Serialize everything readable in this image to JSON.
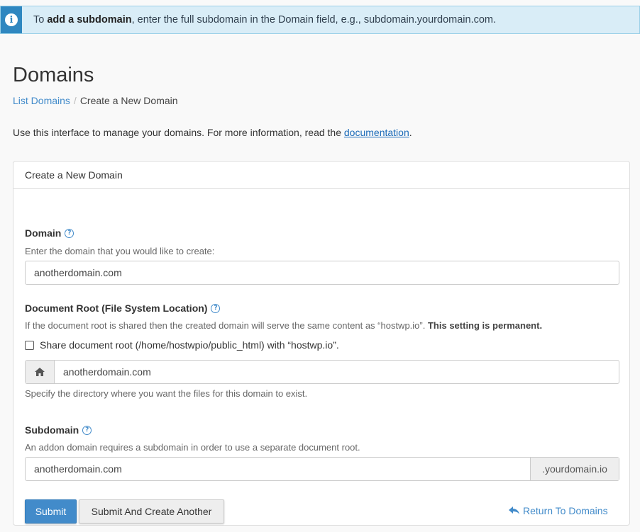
{
  "alert": {
    "prefix": "To ",
    "bold": "add a subdomain",
    "suffix": ", enter the full subdomain in the Domain field, e.g., subdomain.yourdomain.com.",
    "icon": "info-icon"
  },
  "page": {
    "title": "Domains",
    "breadcrumb": {
      "link": "List Domains",
      "separator": "/",
      "current": "Create a New Domain"
    },
    "intro": {
      "text": "Use this interface to manage your domains. For more information, read the ",
      "link": "documentation",
      "end": "."
    }
  },
  "panel": {
    "heading": "Create a New Domain",
    "domain": {
      "label": "Domain",
      "hint": "Enter the domain that you would like to create:",
      "value": "anotherdomain.com"
    },
    "docroot": {
      "label": "Document Root (File System Location)",
      "hint": "If the document root is shared then the created domain will serve the same content as “hostwp.io”.",
      "hint_bold": "This setting is permanent.",
      "checkbox_label": "Share document root (/home/hostwpio/public_html) with “hostwp.io”.",
      "checkbox_checked": false,
      "value": "anotherdomain.com",
      "help": "Specify the directory where you want the files for this domain to exist."
    },
    "subdomain": {
      "label": "Subdomain",
      "hint": "An addon domain requires a subdomain in order to use a separate document root.",
      "value": "anotherdomain.com",
      "suffix": ".yourdomain.io"
    },
    "buttons": {
      "submit": "Submit",
      "submit_another": "Submit And Create Another",
      "return": "Return To Domains"
    }
  },
  "colors": {
    "primary": "#428bca",
    "alert_bg": "#d9edf7",
    "alert_icon_bg": "#2f87c0"
  }
}
